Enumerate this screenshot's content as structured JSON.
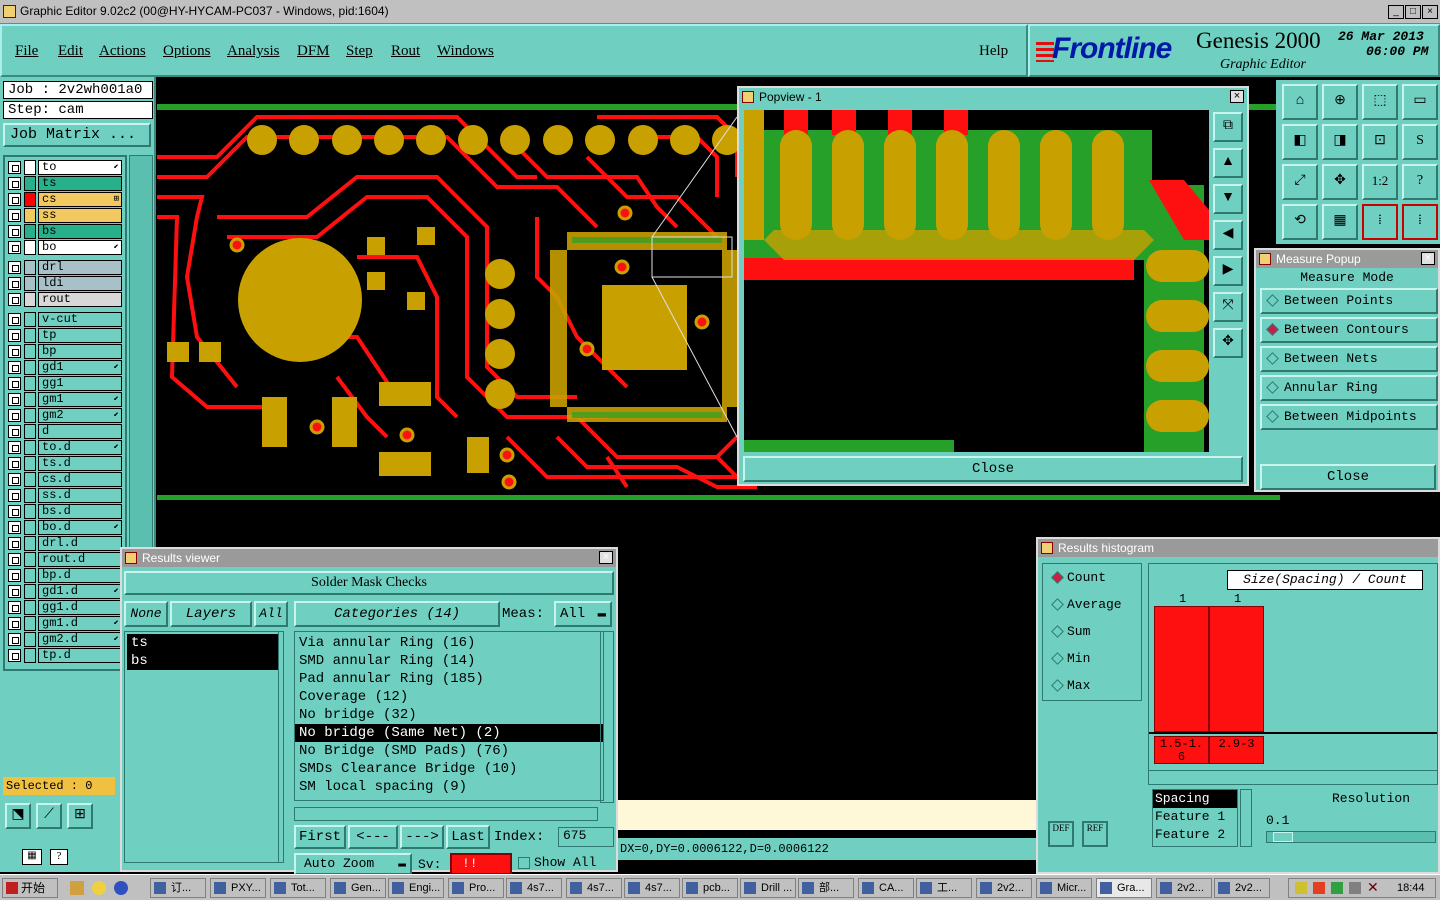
{
  "window": {
    "title": "Graphic Editor 9.02c2 (00@HY-HYCAM-PC037 - Windows, pid:1604)"
  },
  "menu": {
    "items": [
      "File",
      "Edit",
      "Actions",
      "Options",
      "Analysis",
      "DFM",
      "Step",
      "Rout",
      "Windows"
    ],
    "help": "Help"
  },
  "brand": {
    "logo": "Frontline",
    "product": "Genesis 2000",
    "subtitle": "Graphic Editor",
    "date": "26 Mar 2013",
    "time": "06:00 PM"
  },
  "job": {
    "job": "Job : 2v2wh001a0",
    "step": "Step: cam",
    "matrix_btn": "Job Matrix ..."
  },
  "layers": [
    {
      "name": "to",
      "color": "#ffffff",
      "swatch": "#ffffff",
      "sym": "⬋"
    },
    {
      "name": "ts",
      "color": "#27b08a",
      "swatch": "#27b08a",
      "sym": ""
    },
    {
      "name": "cs",
      "color": "#f2c860",
      "swatch": "#ff0000",
      "sym": "⊞"
    },
    {
      "name": "ss",
      "color": "#f2c860",
      "swatch": "#f2c860",
      "sym": ""
    },
    {
      "name": "bs",
      "color": "#27b08a",
      "swatch": "#27b08a",
      "sym": ""
    },
    {
      "name": "bo",
      "color": "#ffffff",
      "swatch": "#ffffff",
      "sym": "⬋"
    },
    {
      "name": "drl",
      "color": "#a8c0c8",
      "swatch": "#a8c0c8",
      "sym": ""
    },
    {
      "name": "ldi",
      "color": "#a8c0c8",
      "swatch": "#a8c0c8",
      "sym": ""
    },
    {
      "name": "rout",
      "color": "#d8d8d8",
      "swatch": "#d8d8d8",
      "sym": ""
    },
    {
      "name": "v-cut",
      "color": "#6fcfc0",
      "swatch": "#6fcfc0",
      "sym": ""
    },
    {
      "name": "tp",
      "color": "#6fcfc0",
      "swatch": "#6fcfc0",
      "sym": ""
    },
    {
      "name": "bp",
      "color": "#6fcfc0",
      "swatch": "#6fcfc0",
      "sym": ""
    },
    {
      "name": "gd1",
      "color": "#6fcfc0",
      "swatch": "#6fcfc0",
      "sym": "⬋"
    },
    {
      "name": "gg1",
      "color": "#6fcfc0",
      "swatch": "#6fcfc0",
      "sym": ""
    },
    {
      "name": "gm1",
      "color": "#6fcfc0",
      "swatch": "#6fcfc0",
      "sym": "⬋"
    },
    {
      "name": "gm2",
      "color": "#6fcfc0",
      "swatch": "#6fcfc0",
      "sym": "⬋"
    },
    {
      "name": "d",
      "color": "#6fcfc0",
      "swatch": "#6fcfc0",
      "sym": ""
    },
    {
      "name": "to.d",
      "color": "#6fcfc0",
      "swatch": "#6fcfc0",
      "sym": "⬋"
    },
    {
      "name": "ts.d",
      "color": "#6fcfc0",
      "swatch": "#6fcfc0",
      "sym": ""
    },
    {
      "name": "cs.d",
      "color": "#6fcfc0",
      "swatch": "#6fcfc0",
      "sym": ""
    },
    {
      "name": "ss.d",
      "color": "#6fcfc0",
      "swatch": "#6fcfc0",
      "sym": ""
    },
    {
      "name": "bs.d",
      "color": "#6fcfc0",
      "swatch": "#6fcfc0",
      "sym": ""
    },
    {
      "name": "bo.d",
      "color": "#6fcfc0",
      "swatch": "#6fcfc0",
      "sym": "⬋"
    },
    {
      "name": "drl.d",
      "color": "#6fcfc0",
      "swatch": "#6fcfc0",
      "sym": ""
    },
    {
      "name": "rout.d",
      "color": "#6fcfc0",
      "swatch": "#6fcfc0",
      "sym": ""
    },
    {
      "name": "bp.d",
      "color": "#6fcfc0",
      "swatch": "#6fcfc0",
      "sym": ""
    },
    {
      "name": "gd1.d",
      "color": "#6fcfc0",
      "swatch": "#6fcfc0",
      "sym": "⬋"
    },
    {
      "name": "gg1.d",
      "color": "#6fcfc0",
      "swatch": "#6fcfc0",
      "sym": ""
    },
    {
      "name": "gm1.d",
      "color": "#6fcfc0",
      "swatch": "#6fcfc0",
      "sym": "⬋"
    },
    {
      "name": "gm2.d",
      "color": "#6fcfc0",
      "swatch": "#6fcfc0",
      "sym": "⬋"
    },
    {
      "name": "tp.d",
      "color": "#6fcfc0",
      "swatch": "#6fcfc0",
      "sym": ""
    }
  ],
  "selected": "Selected : 0",
  "popview": {
    "title": "Popview - 1",
    "close": "Close"
  },
  "measure": {
    "title": "Measure Popup",
    "mode_label": "Measure Mode",
    "modes": [
      "Between Points",
      "Between Contours",
      "Between Nets",
      "Annular Ring",
      "Between Midpoints"
    ],
    "selected_mode": "Between Contours",
    "close": "Close"
  },
  "results": {
    "title": "Results viewer",
    "header": "Solder Mask Checks",
    "none": "None",
    "layers": "Layers",
    "all": "All",
    "categories": "Categories (14)",
    "meas_label": "Meas:",
    "meas_value": "All",
    "layer_list": [
      "ts",
      "bs"
    ],
    "items": [
      "Via annular Ring (16)",
      "SMD annular Ring (14)",
      "Pad annular Ring (185)",
      "Coverage (12)",
      "No bridge (32)",
      "No bridge (Same Net) (2)",
      "No Bridge (SMD Pads) (76)",
      "SMDs Clearance Bridge (10)",
      "SM local spacing (9)"
    ],
    "selected_item": "No bridge (Same Net) (2)",
    "first": "First",
    "prev": "<---",
    "next": "--->",
    "last": "Last",
    "index_label": "Index:",
    "index_value": "675",
    "auto_zoom": "Auto Zoom",
    "sv": "Sv:",
    "sv_mark": "!!",
    "show_all": "Show All"
  },
  "histogram": {
    "title": "Results histogram",
    "stats": [
      "Count",
      "Average",
      "Sum",
      "Min",
      "Max"
    ],
    "selected_stat": "Count",
    "axis_title": "Size(Spacing) / Count",
    "bars": [
      {
        "count": "1",
        "range": "1.5-1.6"
      },
      {
        "count": "1",
        "range": "2.9-3"
      }
    ],
    "list": [
      "Spacing",
      "Feature 1",
      "Feature 2"
    ],
    "list_selected": "Spacing",
    "resolution_label": "Resolution",
    "resolution_value": "0.1",
    "def": "DEF",
    "ref": "REF"
  },
  "status": {
    "readout": "DX=0,DY=0.0006122,D=0.0006122"
  },
  "taskbar": {
    "start": "开始",
    "tasks": [
      "订...",
      "PXY...",
      "Tot...",
      "Gen...",
      "Engi...",
      "Pro...",
      "4s7...",
      "4s7...",
      "4s7...",
      "pcb...",
      "Drill ...",
      "部...",
      "CA...",
      "工...",
      "2v2...",
      "Micr...",
      "Gra...",
      "2v2...",
      "2v2..."
    ],
    "active_task": "Gra...",
    "clock": "18:44"
  },
  "colors": {
    "panel": "#6fcfc0",
    "copper": "#c8a000",
    "trace": "#ff1010",
    "mask": "#27a02a"
  }
}
